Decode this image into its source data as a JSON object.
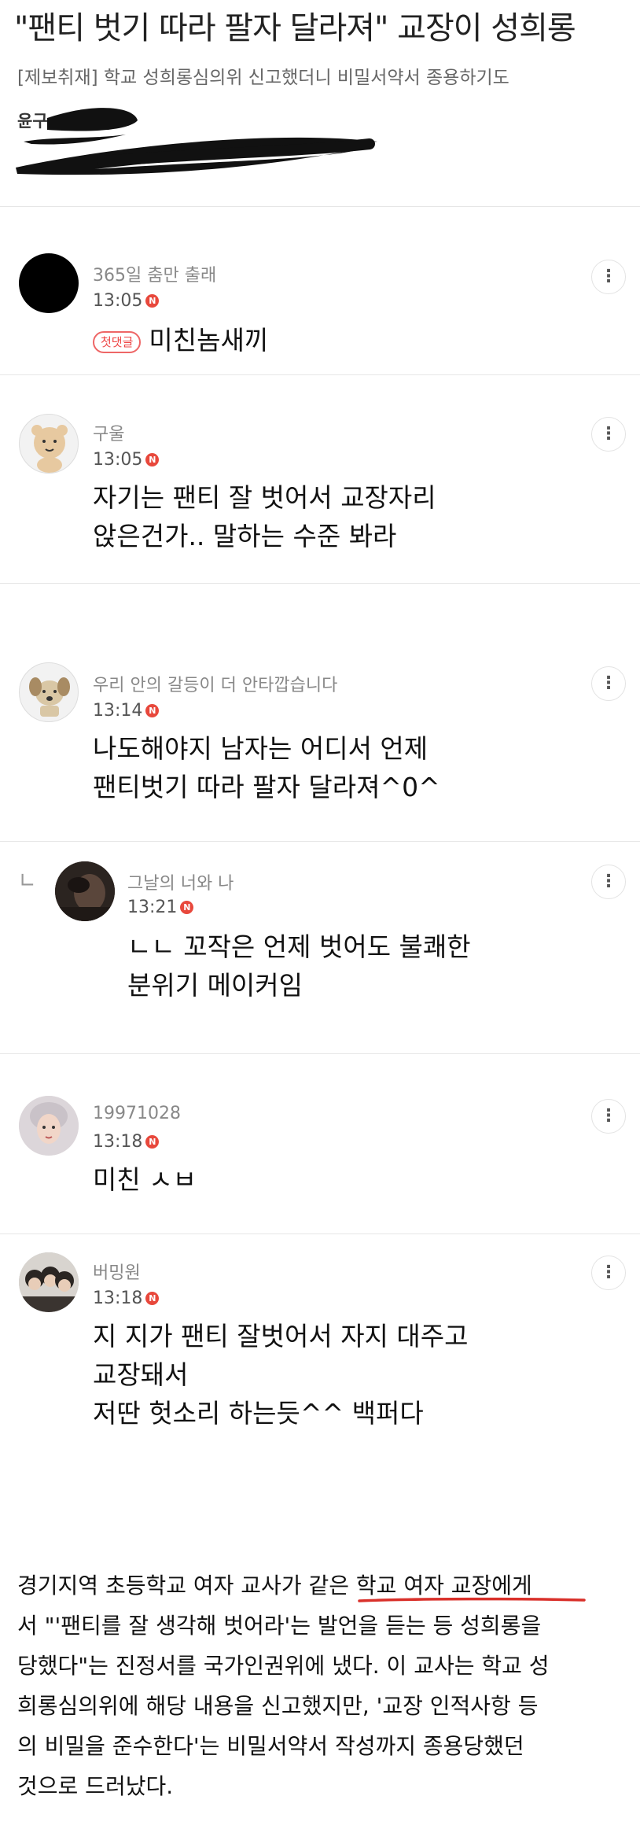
{
  "article": {
    "headline": "\"팬티 벗기 따라 팔자 달라져\" 교장이 성희롱",
    "subhead": "[제보취재] 학교 성희롱심의위 신고했더니 비밀서약서 종용하기도",
    "byline_visible": "윤구",
    "body_lines": [
      "경기지역 초등학교 여자 교사가 같은 학교 여자 교장에게",
      "서 \"'팬티를 잘 생각해 벗어라'는 발언을 듣는 등 성희롱을",
      "당했다\"는 진정서를 국가인권위에 냈다. 이 교사는 학교 성",
      "희롱심의위에 해당 내용을 신고했지만, '교장 인적사항 등",
      "의 비밀을 준수한다'는 비밀서약서 작성까지 종용당했던",
      "것으로 드러났다."
    ]
  },
  "badges": {
    "new": "N",
    "first_comment": "첫댓글"
  },
  "more_icon": "⋮",
  "comments": [
    {
      "nickname": "365일 춤만 출래",
      "time": "13:05",
      "lines": [
        "미친놈새끼"
      ],
      "first": true,
      "avatar": "black-circle"
    },
    {
      "nickname": "구울",
      "time": "13:05",
      "lines": [
        "자기는 팬티 잘 벗어서 교장자리",
        "앉은건가.. 말하는 수준 봐라"
      ],
      "avatar": "cartoon-bear"
    },
    {
      "nickname": "우리 안의 갈등이 더 안타깝습니다",
      "time": "13:14",
      "lines": [
        "나도해야지 남자는 어디서 언제",
        "팬티벗기 따라 팔자 달라져^0^"
      ],
      "avatar": "cartoon-dog"
    },
    {
      "nickname": "그날의 너와 나",
      "time": "13:21",
      "lines": [
        "ㄴㄴ 꼬작은 언제 벗어도 불쾌한",
        "분위기 메이커임"
      ],
      "reply": true,
      "avatar": "photo-dark"
    },
    {
      "nickname": "19971028",
      "time": "13:18",
      "lines": [
        "미친 ㅅㅂ"
      ],
      "avatar": "photo-face"
    },
    {
      "nickname": "버밍원",
      "time": "13:18",
      "lines": [
        "지 지가 팬티 잘벗어서 자지 대주고",
        "교장돼서",
        "저딴 헛소리 하는듯^^ 백퍼다"
      ],
      "avatar": "photo-group"
    }
  ],
  "colors": {
    "badge_red": "#e8483c",
    "underline_red": "#d9302a"
  }
}
